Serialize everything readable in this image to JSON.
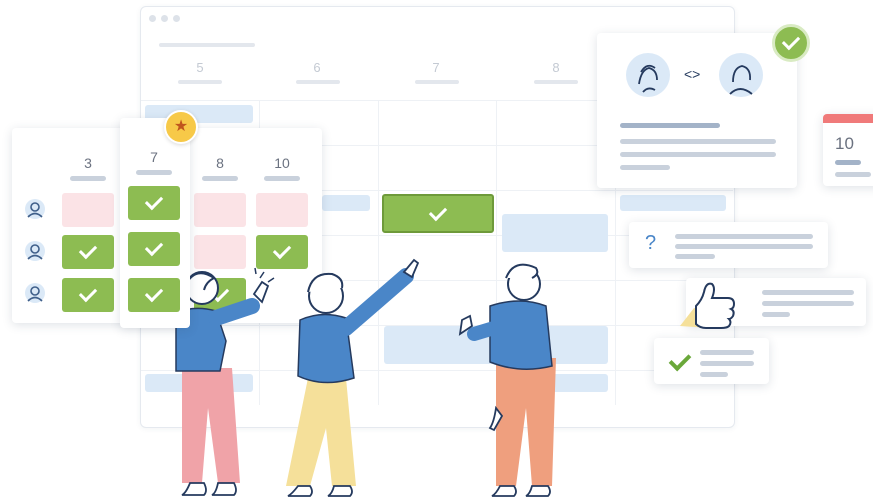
{
  "calendar": {
    "day_numbers": [
      "5",
      "6",
      "7",
      "8"
    ]
  },
  "schedule_card": {
    "day_numbers": [
      "3",
      "7",
      "8",
      "10"
    ]
  },
  "small_calendar": {
    "day": "10"
  },
  "swap_card": {
    "swap_symbol": "<>"
  },
  "question_card": {
    "symbol": "?"
  },
  "colors": {
    "check_green": "#8dbc52",
    "soft_blue": "#dbe9f7",
    "soft_pink": "#fbe3e6",
    "star_yellow": "#f7c948",
    "shirt_blue": "#4a86c8",
    "pants_pink": "#f0a3a8",
    "pants_yellow": "#f5e09a",
    "pants_orange": "#ef9f7e"
  }
}
